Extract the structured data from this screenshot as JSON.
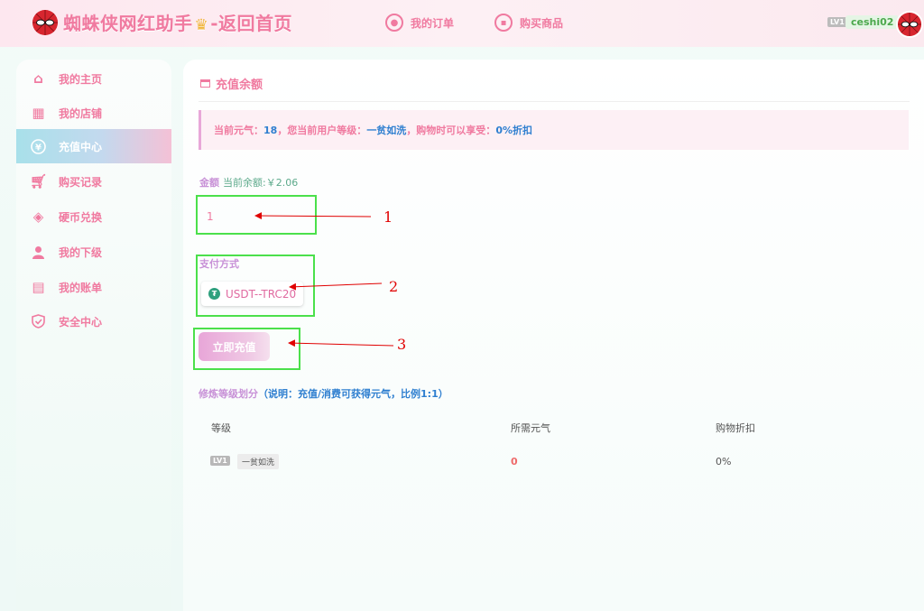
{
  "header": {
    "brand_title": "蜘蛛侠网红助手",
    "brand_suffix": "-返回首页",
    "nav": [
      {
        "label": "我的订单",
        "icon": "order-icon"
      },
      {
        "label": "购买商品",
        "icon": "shop-icon"
      }
    ],
    "user_level": "LV1",
    "username": "ceshi02"
  },
  "sidebar": {
    "items": [
      {
        "label": "我的主页",
        "icon": "home-icon"
      },
      {
        "label": "我的店铺",
        "icon": "store-icon"
      },
      {
        "label": "充值中心",
        "icon": "yen-icon",
        "active": true
      },
      {
        "label": "购买记录",
        "icon": "cart-icon"
      },
      {
        "label": "硬币兑换",
        "icon": "diamond-icon"
      },
      {
        "label": "我的下级",
        "icon": "user-icon"
      },
      {
        "label": "我的账单",
        "icon": "bill-icon"
      },
      {
        "label": "安全中心",
        "icon": "shield-icon"
      }
    ]
  },
  "main": {
    "title": "充值余额",
    "notice": {
      "prefix": "当前元气：",
      "qi": "18",
      "mid": "，您当前用户等级：",
      "level": "一贫如洗",
      "mid2": "，购物时可以享受：",
      "discount": "0%折扣"
    },
    "amount": {
      "label": "金额",
      "balance": "当前余额:￥2.06",
      "value": "1"
    },
    "payment": {
      "label": "支付方式",
      "option": "USDT--TRC20"
    },
    "recharge_button": "立即充值",
    "levels": {
      "title": "修炼等级划分",
      "note": "（说明：充值/消费可获得元气，比例1:1）",
      "headers": [
        "等级",
        "所需元气",
        "购物折扣"
      ],
      "rows": [
        {
          "badge": "LV1",
          "name": "一贫如洗",
          "qi": "0",
          "discount": "0%"
        }
      ]
    }
  },
  "annotations": [
    "1",
    "2",
    "3"
  ],
  "colors": {
    "accent_pink": "#f07aa0",
    "highlight_blue": "#2f7fd0",
    "annotation_green": "#4be04b",
    "annotation_red": "#e00000"
  }
}
